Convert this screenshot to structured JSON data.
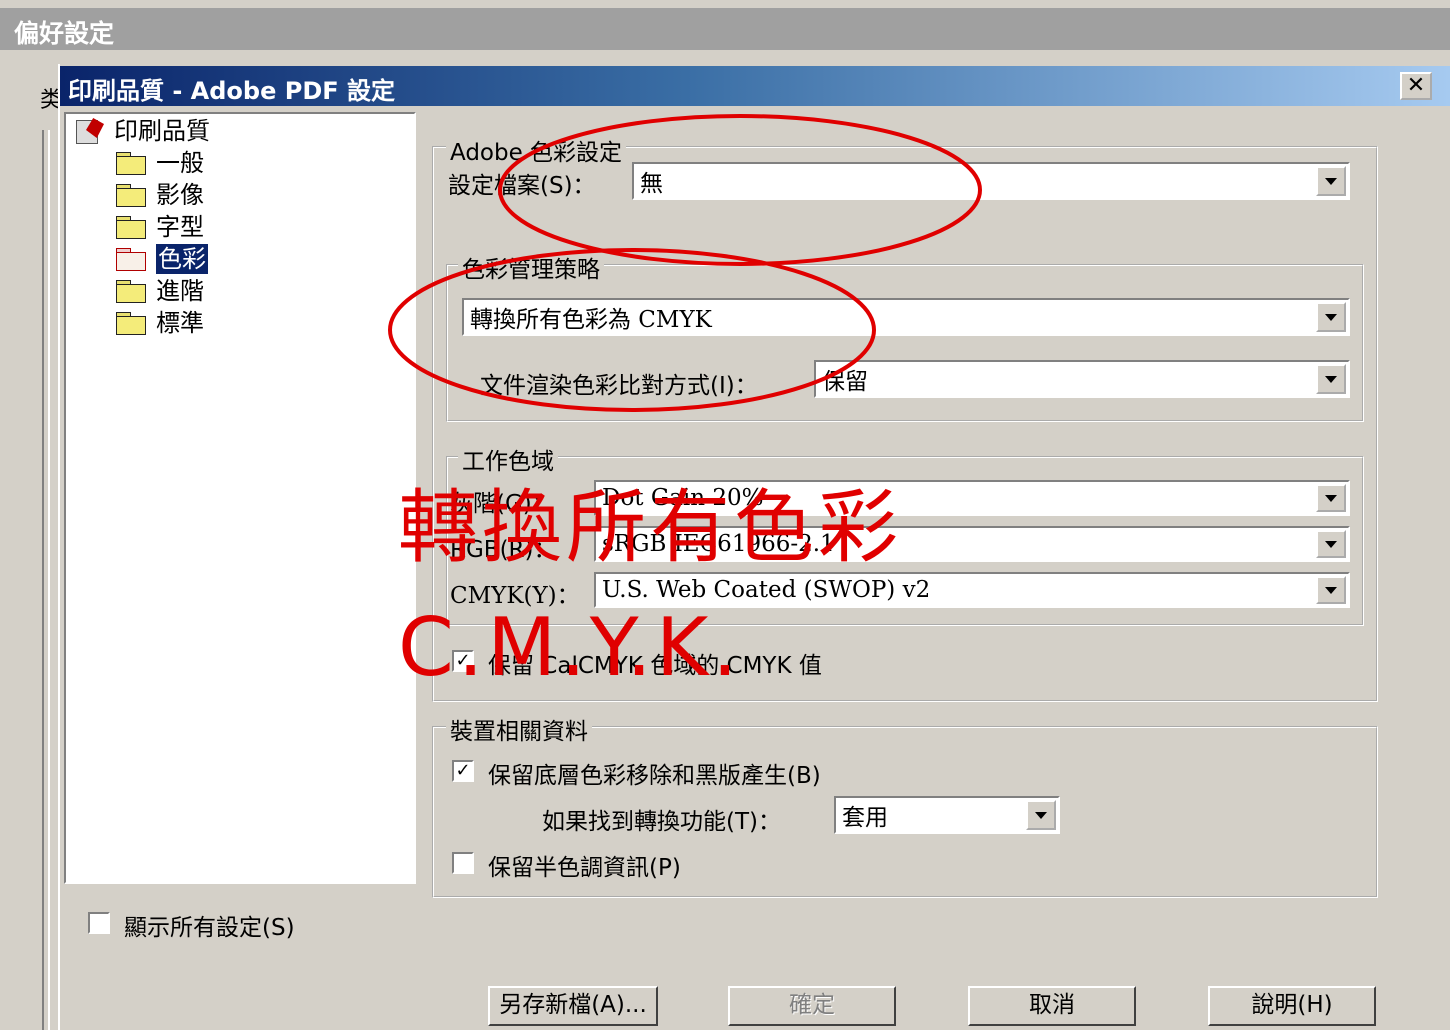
{
  "outer_window": {
    "title": "偏好設定",
    "side_glyph": "类"
  },
  "dialog": {
    "title": "印刷品質 - Adobe PDF 設定",
    "close_symbol": "✕"
  },
  "tree": {
    "root": "印刷品質",
    "items": [
      {
        "label": "一般"
      },
      {
        "label": "影像"
      },
      {
        "label": "字型"
      },
      {
        "label": "色彩",
        "selected": true
      },
      {
        "label": "進階"
      },
      {
        "label": "標準"
      }
    ]
  },
  "adobe_color": {
    "group_title": "Adobe 色彩設定",
    "settings_file_label": "設定檔案(S)：",
    "settings_file_value": "無"
  },
  "color_policy": {
    "group_title": "色彩管理策略",
    "policy_value": "轉換所有色彩為 CMYK",
    "intent_label": "文件渲染色彩比對方式(I)：",
    "intent_value": "保留"
  },
  "working_spaces": {
    "group_title": "工作色域",
    "gray_label": "灰階(G)：",
    "gray_value": "Dot Gain 20%",
    "rgb_label": "RGB(R)：",
    "rgb_value": "sRGB IEC61966-2.1",
    "cmyk_label": "CMYK(Y)：",
    "cmyk_value": "U.S. Web Coated (SWOP) v2",
    "preserve_label": "保留 CalCMYK 色域的 CMYK 值",
    "preserve_checked": true
  },
  "device": {
    "group_title": "裝置相關資料",
    "ucr_label": "保留底層色彩移除和黑版產生(B)",
    "ucr_checked": true,
    "transfer_label": "如果找到轉換功能(T)：",
    "transfer_value": "套用",
    "halftone_label": "保留半色調資訊(P)",
    "halftone_checked": false
  },
  "show_all": {
    "label": "顯示所有設定(S)",
    "checked": false
  },
  "buttons": {
    "save_as": "另存新檔(A)...",
    "ok": "確定",
    "cancel": "取消",
    "help": "說明(H)"
  },
  "annotations": {
    "line1": "轉換所有色彩",
    "line2": "C.M.Y.K.",
    "color": "#e00000"
  },
  "colors": {
    "title_start": "#0a246a",
    "title_end": "#a6caf0",
    "face": "#d4d0c8"
  }
}
